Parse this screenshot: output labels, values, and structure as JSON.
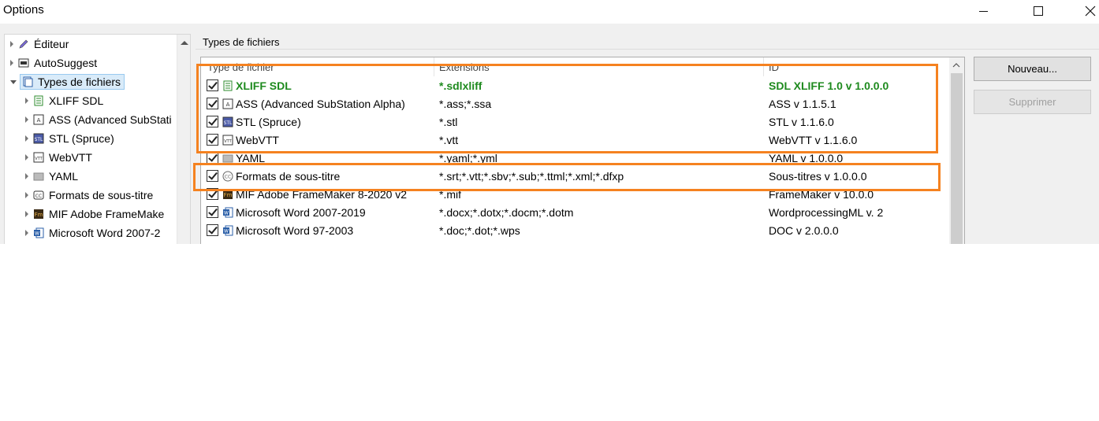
{
  "window": {
    "title": "Options"
  },
  "tree": {
    "items": [
      {
        "label": "Éditeur",
        "icon": "pencil-icon"
      },
      {
        "label": "AutoSuggest",
        "icon": "autosuggest-icon"
      },
      {
        "label": "Types de fichiers",
        "icon": "file-types-icon",
        "selected": true,
        "expanded": true
      },
      {
        "label": "XLIFF SDL",
        "icon": "xliff-icon"
      },
      {
        "label": "ASS (Advanced SubStati",
        "icon": "ass-icon"
      },
      {
        "label": "STL (Spruce)",
        "icon": "stl-icon"
      },
      {
        "label": "WebVTT",
        "icon": "vtt-icon"
      },
      {
        "label": "YAML",
        "icon": "yaml-icon"
      },
      {
        "label": "Formats de sous-titre",
        "icon": "cc-icon"
      },
      {
        "label": "MIF Adobe FrameMake",
        "icon": "fm-icon"
      },
      {
        "label": "Microsoft Word 2007-2",
        "icon": "word-icon"
      }
    ]
  },
  "group": {
    "title": "Types de fichiers"
  },
  "list": {
    "columns": [
      "Type de fichier",
      "Extensions",
      "ID"
    ],
    "rows": [
      {
        "name": "XLIFF SDL",
        "ext": "*.sdlxliff",
        "id": "SDL XLIFF 1.0 v 1.0.0.0",
        "checked": true,
        "highlight": true
      },
      {
        "name": "ASS (Advanced SubStation Alpha)",
        "ext": "*.ass;*.ssa",
        "id": "ASS v 1.1.5.1",
        "checked": true
      },
      {
        "name": "STL (Spruce)",
        "ext": "*.stl",
        "id": "STL v 1.1.6.0",
        "checked": true
      },
      {
        "name": "WebVTT",
        "ext": "*.vtt",
        "id": "WebVTT v 1.1.6.0",
        "checked": true
      },
      {
        "name": "YAML",
        "ext": "*.yaml;*.yml",
        "id": "YAML v 1.0.0.0",
        "checked": true
      },
      {
        "name": "Formats de sous-titre",
        "ext": "*.srt;*.vtt;*.sbv;*.sub;*.ttml;*.xml;*.dfxp",
        "id": "Sous-titres v 1.0.0.0",
        "checked": true
      },
      {
        "name": "MIF Adobe FrameMaker 8-2020 v2",
        "ext": "*.mif",
        "id": "FrameMaker v 10.0.0",
        "checked": true
      },
      {
        "name": "Microsoft Word 2007-2019",
        "ext": "*.docx;*.dotx;*.docm;*.dotm",
        "id": "WordprocessingML v. 2",
        "checked": true
      },
      {
        "name": "Microsoft Word 97-2003",
        "ext": "*.doc;*.dot;*.wps",
        "id": "DOC v 2.0.0.0",
        "checked": true
      }
    ]
  },
  "buttons": {
    "new_label": "Nouveau...",
    "delete_label": "Supprimer"
  },
  "colors": {
    "highlight": "#f58220",
    "selected_bg": "#d9ebf9",
    "green_text": "#1e8a1e"
  }
}
